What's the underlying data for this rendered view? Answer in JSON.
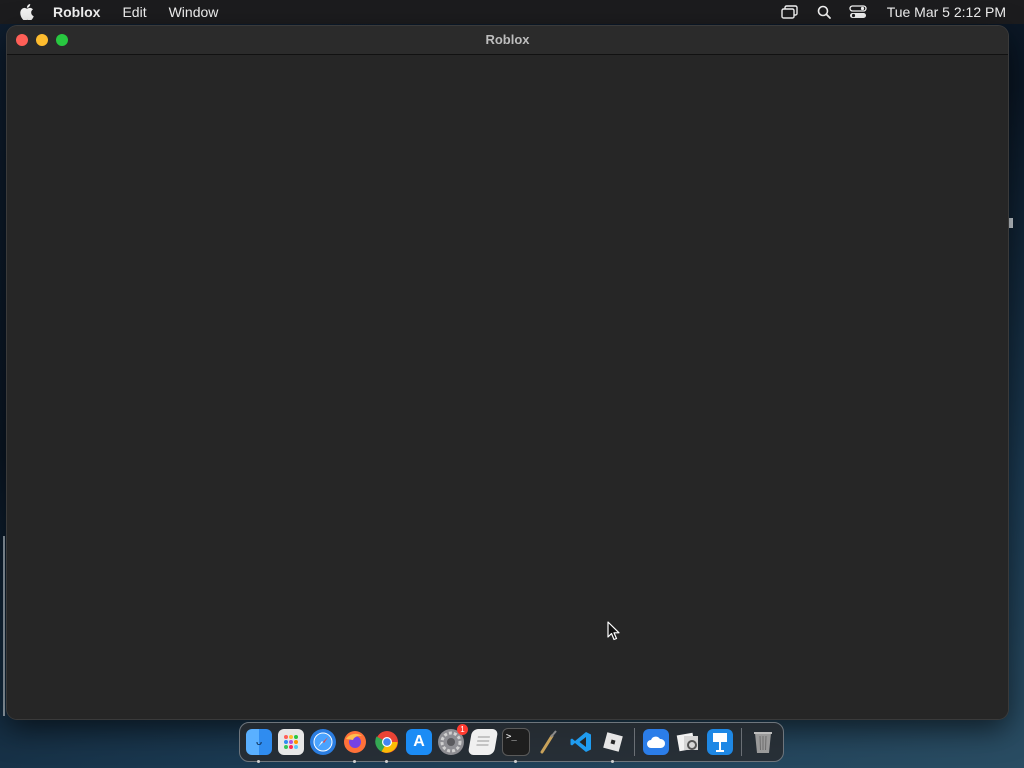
{
  "menubar": {
    "app_name": "Roblox",
    "items": [
      "Edit",
      "Window"
    ],
    "clock": "Tue Mar 5  2:12 PM",
    "status_icons": [
      "screen-mirroring-icon",
      "spotlight-search-icon",
      "control-center-icon"
    ]
  },
  "window": {
    "title": "Roblox"
  },
  "dock": {
    "apps": [
      {
        "name": "Finder",
        "icon": "finder-icon",
        "color": "#2f8cf0",
        "running": true
      },
      {
        "name": "Launchpad",
        "icon": "launchpad-icon",
        "color": "#d9d9d9",
        "running": false
      },
      {
        "name": "Safari",
        "icon": "safari-icon",
        "color": "#2a7de1",
        "running": false
      },
      {
        "name": "Firefox",
        "icon": "firefox-icon",
        "color": "#ff7139",
        "running": true
      },
      {
        "name": "Chrome",
        "icon": "chrome-icon",
        "color": "#34a853",
        "running": true
      },
      {
        "name": "App Store",
        "icon": "app-store-icon",
        "color": "#1b8cf5",
        "running": false
      },
      {
        "name": "System Settings",
        "icon": "system-settings-icon",
        "color": "#8e8e93",
        "running": false,
        "badge": "1"
      },
      {
        "name": "Script Editor",
        "icon": "script-editor-icon",
        "color": "#e5e5e5",
        "running": false
      },
      {
        "name": "Terminal",
        "icon": "terminal-icon",
        "color": "#1e1e1e",
        "running": true
      },
      {
        "name": "Instruments",
        "icon": "instruments-icon",
        "color": "#3a3a3a",
        "running": false
      },
      {
        "name": "Visual Studio Code",
        "icon": "vscode-icon",
        "color": "#1f9cf0",
        "running": false
      },
      {
        "name": "Roblox",
        "icon": "roblox-icon",
        "color": "#e6e6e6",
        "running": true
      }
    ],
    "others": [
      {
        "name": "Weather",
        "icon": "weather-icon",
        "color": "#2b7de9"
      },
      {
        "name": "Preview",
        "icon": "preview-icon",
        "color": "#d0d0d0"
      },
      {
        "name": "Keynote",
        "icon": "keynote-icon",
        "color": "#1e88e5"
      }
    ],
    "trash": {
      "name": "Trash",
      "icon": "trash-icon"
    }
  }
}
